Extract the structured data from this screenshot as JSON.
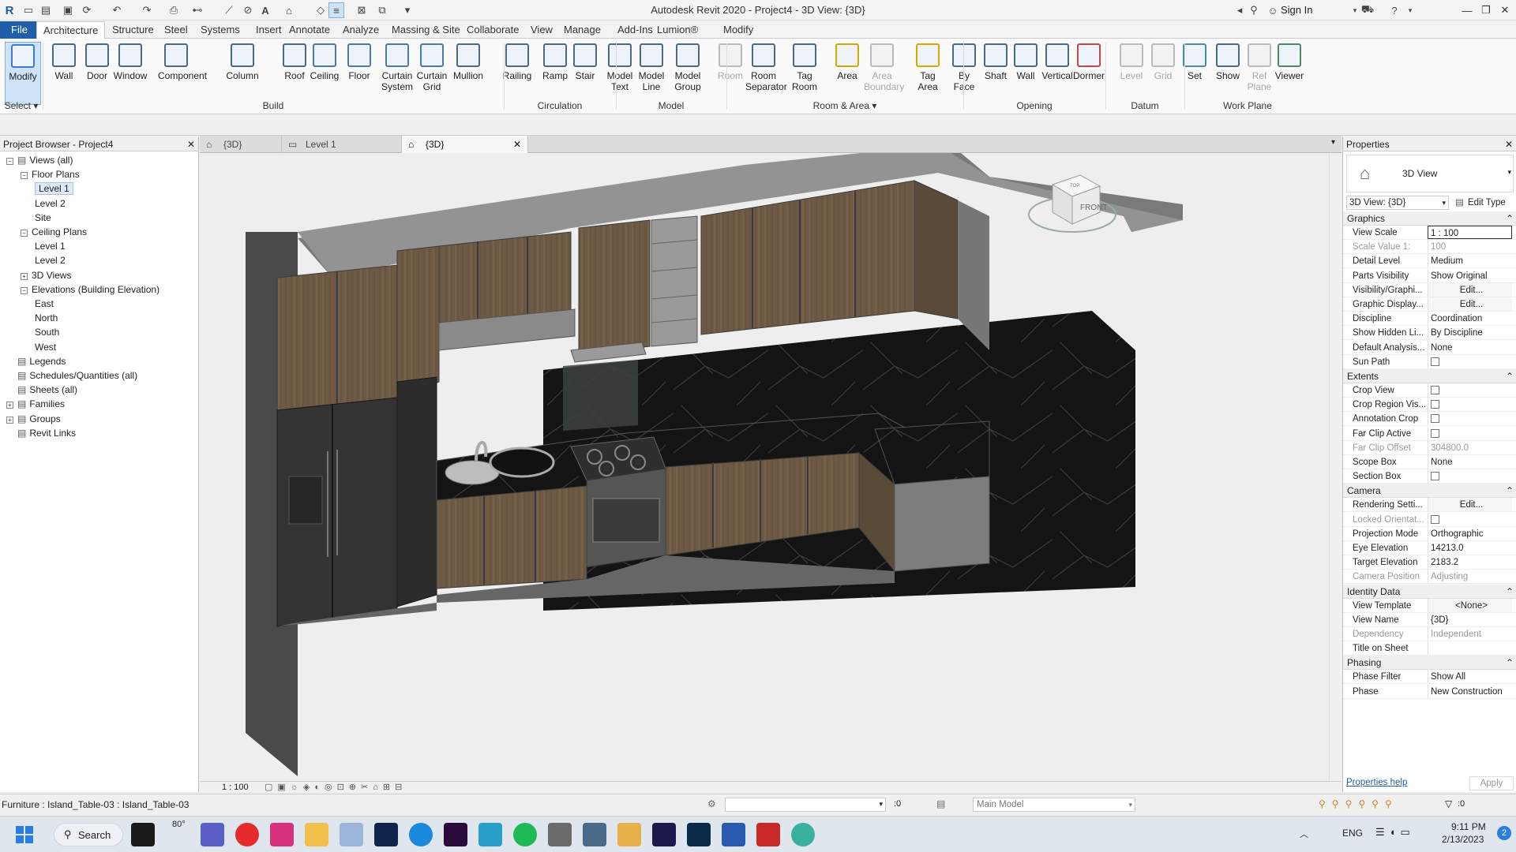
{
  "app": {
    "title": "Autodesk Revit 2020 - Project4 - 3D View: {3D}",
    "sign_in": "Sign In"
  },
  "ribbon_tabs": [
    "File",
    "Architecture",
    "Structure",
    "Steel",
    "Systems",
    "Insert",
    "Annotate",
    "Analyze",
    "Massing & Site",
    "Collaborate",
    "View",
    "Manage",
    "Add-Ins",
    "Lumion®",
    "Modify"
  ],
  "ribbon": {
    "buttons": [
      {
        "l1": "Modify",
        "l2": "",
        "icon": "modify-arrow-icon",
        "dim": false
      },
      {
        "l1": "Wall",
        "l2": "",
        "icon": "wall-icon",
        "dim": false
      },
      {
        "l1": "Door",
        "l2": "",
        "icon": "door-icon",
        "dim": false
      },
      {
        "l1": "Window",
        "l2": "",
        "icon": "window-icon",
        "dim": false
      },
      {
        "l1": "Component",
        "l2": "",
        "icon": "component-icon",
        "dim": false
      },
      {
        "l1": "Column",
        "l2": "",
        "icon": "column-icon",
        "dim": false
      },
      {
        "l1": "Roof",
        "l2": "",
        "icon": "roof-icon",
        "dim": false
      },
      {
        "l1": "Ceiling",
        "l2": "",
        "icon": "ceiling-icon",
        "dim": false
      },
      {
        "l1": "Floor",
        "l2": "",
        "icon": "floor-icon",
        "dim": false
      },
      {
        "l1": "Curtain",
        "l2": "System",
        "icon": "curtain-system-icon",
        "dim": false
      },
      {
        "l1": "Curtain",
        "l2": "Grid",
        "icon": "curtain-grid-icon",
        "dim": false
      },
      {
        "l1": "Mullion",
        "l2": "",
        "icon": "mullion-icon",
        "dim": false
      },
      {
        "l1": "Railing",
        "l2": "",
        "icon": "railing-icon",
        "dim": false
      },
      {
        "l1": "Ramp",
        "l2": "",
        "icon": "ramp-icon",
        "dim": false
      },
      {
        "l1": "Stair",
        "l2": "",
        "icon": "stair-icon",
        "dim": false
      },
      {
        "l1": "Model",
        "l2": "Text",
        "icon": "model-text-icon",
        "dim": false
      },
      {
        "l1": "Model",
        "l2": "Line",
        "icon": "model-line-icon",
        "dim": false
      },
      {
        "l1": "Model",
        "l2": "Group",
        "icon": "model-group-icon",
        "dim": false
      },
      {
        "l1": "Room",
        "l2": "",
        "icon": "room-icon",
        "dim": true
      },
      {
        "l1": "Room",
        "l2": "Separator",
        "icon": "room-separator-icon",
        "dim": false
      },
      {
        "l1": "Tag",
        "l2": "Room",
        "icon": "tag-room-icon",
        "dim": false
      },
      {
        "l1": "Area",
        "l2": "",
        "icon": "area-icon",
        "dim": false
      },
      {
        "l1": "Area",
        "l2": "Boundary",
        "icon": "area-boundary-icon",
        "dim": true
      },
      {
        "l1": "Tag",
        "l2": "Area",
        "icon": "tag-area-icon",
        "dim": false
      },
      {
        "l1": "By",
        "l2": "Face",
        "icon": "by-face-icon",
        "dim": false
      },
      {
        "l1": "Shaft",
        "l2": "",
        "icon": "shaft-icon",
        "dim": false
      },
      {
        "l1": "Wall",
        "l2": "",
        "icon": "wall-opening-icon",
        "dim": false
      },
      {
        "l1": "Vertical",
        "l2": "",
        "icon": "vertical-icon",
        "dim": false
      },
      {
        "l1": "Dormer",
        "l2": "",
        "icon": "dormer-icon",
        "dim": false
      },
      {
        "l1": "Level",
        "l2": "",
        "icon": "level-icon",
        "dim": true
      },
      {
        "l1": "Grid",
        "l2": "",
        "icon": "grid-icon",
        "dim": true
      },
      {
        "l1": "Set",
        "l2": "",
        "icon": "set-icon",
        "dim": false
      },
      {
        "l1": "Show",
        "l2": "",
        "icon": "show-icon",
        "dim": false
      },
      {
        "l1": "Ref",
        "l2": "Plane",
        "icon": "ref-plane-icon",
        "dim": true
      },
      {
        "l1": "Viewer",
        "l2": "",
        "icon": "viewer-icon",
        "dim": false
      }
    ],
    "panels": [
      "Select ▾",
      "Build",
      "Circulation",
      "Model",
      "Room & Area ▾",
      "Opening",
      "Datum",
      "Work Plane"
    ]
  },
  "browser": {
    "title": "Project Browser - Project4",
    "items": [
      {
        "label": "Views (all)",
        "depth": 0,
        "toggle": "−",
        "icon": true
      },
      {
        "label": "Floor Plans",
        "depth": 1,
        "toggle": "−"
      },
      {
        "label": "Level 1",
        "depth": 2,
        "selected": true
      },
      {
        "label": "Level 2",
        "depth": 2
      },
      {
        "label": "Site",
        "depth": 2
      },
      {
        "label": "Ceiling Plans",
        "depth": 1,
        "toggle": "−"
      },
      {
        "label": "Level 1",
        "depth": 2
      },
      {
        "label": "Level 2",
        "depth": 2
      },
      {
        "label": "3D Views",
        "depth": 1,
        "toggle": "+"
      },
      {
        "label": "Elevations (Building Elevation)",
        "depth": 1,
        "toggle": "−"
      },
      {
        "label": "East",
        "depth": 2
      },
      {
        "label": "North",
        "depth": 2
      },
      {
        "label": "South",
        "depth": 2
      },
      {
        "label": "West",
        "depth": 2
      },
      {
        "label": "Legends",
        "depth": 0,
        "icon": true
      },
      {
        "label": "Schedules/Quantities (all)",
        "depth": 0,
        "icon": true
      },
      {
        "label": "Sheets (all)",
        "depth": 0,
        "icon": true
      },
      {
        "label": "Families",
        "depth": 0,
        "toggle": "+",
        "icon": true
      },
      {
        "label": "Groups",
        "depth": 0,
        "toggle": "+",
        "icon": true
      },
      {
        "label": "Revit Links",
        "depth": 0,
        "icon": true
      }
    ]
  },
  "view_tabs": [
    {
      "label": "{3D}"
    },
    {
      "label": "Level 1"
    },
    {
      "label": "{3D}",
      "active": true
    }
  ],
  "viewcube": {
    "face": "FRONT",
    "top": "TOP"
  },
  "view_bar": {
    "scale": "1 : 100"
  },
  "properties": {
    "title": "Properties",
    "type_name": "3D View",
    "selector": "3D View: {3D}",
    "edit_type": "Edit Type",
    "sections": [
      {
        "name": "Graphics",
        "rows": [
          {
            "k": "View Scale",
            "v": "1 : 100",
            "input": true
          },
          {
            "k": "Scale Value   1:",
            "v": "100",
            "dim": true
          },
          {
            "k": "Detail Level",
            "v": "Medium"
          },
          {
            "k": "Parts Visibility",
            "v": "Show Original"
          },
          {
            "k": "Visibility/Graphi...",
            "v": "Edit...",
            "btn": true
          },
          {
            "k": "Graphic Display...",
            "v": "Edit...",
            "btn": true
          },
          {
            "k": "Discipline",
            "v": "Coordination"
          },
          {
            "k": "Show Hidden Li...",
            "v": "By Discipline"
          },
          {
            "k": "Default Analysis...",
            "v": "None"
          },
          {
            "k": "Sun Path",
            "v": "",
            "cb": true
          }
        ]
      },
      {
        "name": "Extents",
        "rows": [
          {
            "k": "Crop View",
            "v": "",
            "cb": true
          },
          {
            "k": "Crop Region Vis...",
            "v": "",
            "cb": true
          },
          {
            "k": "Annotation Crop",
            "v": "",
            "cb": true
          },
          {
            "k": "Far Clip Active",
            "v": "",
            "cb": true
          },
          {
            "k": "Far Clip Offset",
            "v": "304800.0",
            "dim": true
          },
          {
            "k": "Scope Box",
            "v": "None"
          },
          {
            "k": "Section Box",
            "v": "",
            "cb": true
          }
        ]
      },
      {
        "name": "Camera",
        "rows": [
          {
            "k": "Rendering Setti...",
            "v": "Edit...",
            "btn": true
          },
          {
            "k": "Locked Orientat...",
            "v": "",
            "cb": true,
            "dim": true
          },
          {
            "k": "Projection Mode",
            "v": "Orthographic"
          },
          {
            "k": "Eye Elevation",
            "v": "14213.0"
          },
          {
            "k": "Target Elevation",
            "v": "2183.2"
          },
          {
            "k": "Camera Position",
            "v": "Adjusting",
            "dim": true
          }
        ]
      },
      {
        "name": "Identity Data",
        "rows": [
          {
            "k": "View Template",
            "v": "<None>",
            "btn": true
          },
          {
            "k": "View Name",
            "v": "{3D}"
          },
          {
            "k": "Dependency",
            "v": "Independent",
            "dim": true
          },
          {
            "k": "Title on Sheet",
            "v": ""
          }
        ]
      },
      {
        "name": "Phasing",
        "rows": [
          {
            "k": "Phase Filter",
            "v": "Show All"
          },
          {
            "k": "Phase",
            "v": "New Construction"
          }
        ]
      }
    ],
    "help": "Properties help",
    "apply": "Apply"
  },
  "status": {
    "text": "Furniture : Island_Table-03 : Island_Table-03",
    "worksets": ":0",
    "model": "Main Model",
    "filter": ":0"
  },
  "taskbar": {
    "search": "Search",
    "temp": "80°",
    "lang": "ENG",
    "time": "9:11 PM",
    "date": "2/13/2023"
  }
}
